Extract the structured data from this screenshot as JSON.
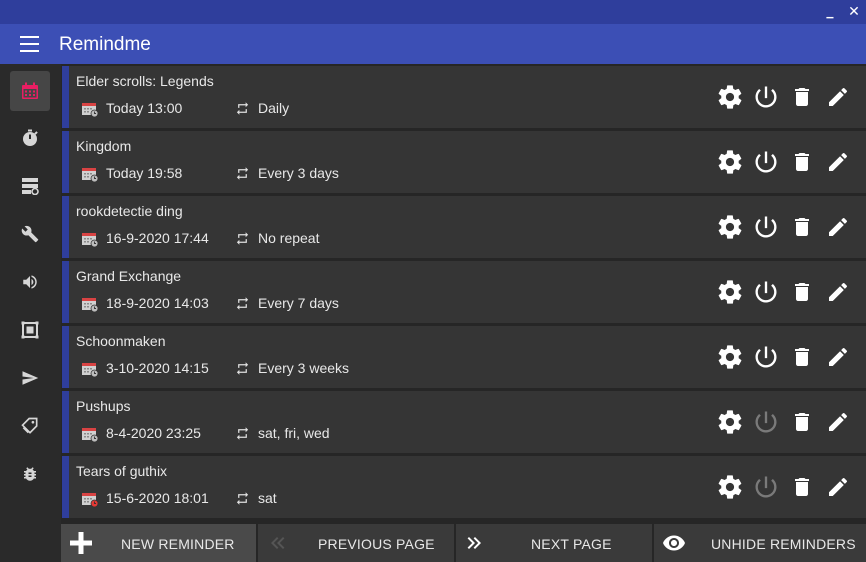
{
  "window": {
    "minimize_glyph": "▁",
    "close_glyph": "✕"
  },
  "app": {
    "title": "Remindme"
  },
  "sidebar": {
    "items": [
      {
        "name": "calendar-icon",
        "active": true
      },
      {
        "name": "stopwatch-icon",
        "active": false
      },
      {
        "name": "storage-icon",
        "active": false
      },
      {
        "name": "wrench-icon",
        "active": false
      },
      {
        "name": "volume-icon",
        "active": false
      },
      {
        "name": "frame-icon",
        "active": false
      },
      {
        "name": "send-icon",
        "active": false
      },
      {
        "name": "tag-icon",
        "active": false
      },
      {
        "name": "bug-icon",
        "active": false
      }
    ]
  },
  "reminders": [
    {
      "name": "Elder scrolls: Legends",
      "date": "Today  13:00",
      "repeat": "Daily",
      "enabled": true,
      "expired": false
    },
    {
      "name": "Kingdom",
      "date": "Today  19:58",
      "repeat": "Every 3 days",
      "enabled": true,
      "expired": false
    },
    {
      "name": "rookdetectie ding",
      "date": "16-9-2020 17:44",
      "repeat": "No repeat",
      "enabled": true,
      "expired": false
    },
    {
      "name": "Grand Exchange",
      "date": "18-9-2020 14:03",
      "repeat": "Every 7 days",
      "enabled": true,
      "expired": false
    },
    {
      "name": "Schoonmaken",
      "date": "3-10-2020 14:15",
      "repeat": "Every 3 weeks",
      "enabled": true,
      "expired": false
    },
    {
      "name": "Pushups",
      "date": "8-4-2020 23:25",
      "repeat": "sat, fri, wed",
      "enabled": false,
      "expired": false
    },
    {
      "name": "Tears of guthix",
      "date": "15-6-2020 18:01",
      "repeat": "sat",
      "enabled": false,
      "expired": true
    }
  ],
  "bottom": {
    "new_label": "NEW REMINDER",
    "prev_label": "PREVIOUS PAGE",
    "next_label": "NEXT PAGE",
    "unhide_label": "UNHIDE REMINDERS"
  },
  "colors": {
    "titlebar": "#2f3e9c",
    "appbar": "#3c4fb5",
    "accent_active_nav": "#e91e63",
    "card": "#353535",
    "card_stripe": "#2f3e9c",
    "disabled_icon": "#7a7a7a"
  }
}
